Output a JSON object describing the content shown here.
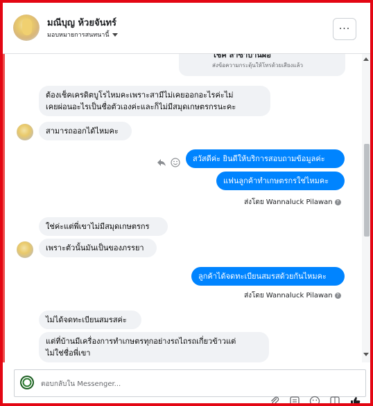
{
  "header": {
    "contact_name": "มณีบุญ ห้วยจันทร์",
    "assign_label": "มอบหมายการสนทนานี้",
    "more_label": "···"
  },
  "top_card": {
    "title": "โชค ลาซาบานผอ",
    "subtitle": "ส่งข้อความกระตุ้นให้โทรด้วยเสียงแล้ว"
  },
  "messages": [
    {
      "side": "in",
      "lines": [
        "ต้องเช็คเครดิตบูโรไหมคะเพราะสามีไม่เคยออกอะไรค่ะไม่",
        "เคยผ่อนอะไรเป็นชื่อตัวเองค่ะและก็ไม่มีสมุดเกษตรกรนะคะ"
      ]
    },
    {
      "side": "in",
      "lines": [
        "สามารถออกได้ไหมคะ"
      ]
    },
    {
      "side": "out",
      "lines": [
        "สวัสดีค่ะ  ยินดีให้บริการสอบถามข้อมูลค่ะ"
      ]
    },
    {
      "side": "out",
      "lines": [
        "แฟนลูกค้าทำเกษตรกรใช่ไหมคะ"
      ]
    },
    {
      "side": "in",
      "lines": [
        "ใช่ค่ะแต่พี่เขาไม่มีสมุดเกษตรกร"
      ]
    },
    {
      "side": "in",
      "lines": [
        "เพราะตัวนั้นมันเป็นของภรรยา"
      ]
    },
    {
      "side": "out",
      "lines": [
        "ลูกค้าได้จดทะเบียนสมรสด้วยกันไหมคะ"
      ]
    },
    {
      "side": "in",
      "lines": [
        "ไม่ได้จดทะเบียนสมรสค่ะ"
      ]
    },
    {
      "side": "in",
      "lines": [
        "แต่ที่บ้านมีเครื่องการทำเกษตรทุกอย่างรถไถรถเกี่ยวข้าวแต่",
        "ไม่ใช่ชื่อพี่เขา"
      ]
    }
  ],
  "sent_by": {
    "prefix": "ส่งโดย",
    "agent": "Wannaluck Pilawan",
    "info": "?"
  },
  "composer": {
    "placeholder": "ตอบกลับใน Messenger..."
  },
  "icons": {
    "more": "more-dots-icon",
    "reply": "reply-arrow-icon",
    "emoji": "emoji-icon",
    "info": "info-icon",
    "attach": "paperclip-icon",
    "saved_reply": "saved-reply-icon",
    "emoji_picker": "emoji-icon",
    "gif": "gif-icon",
    "like": "thumbs-up-icon"
  },
  "colors": {
    "outgoing_bubble": "#0084ff",
    "incoming_bubble": "#f0f2f5",
    "frame_border": "#e30613"
  }
}
